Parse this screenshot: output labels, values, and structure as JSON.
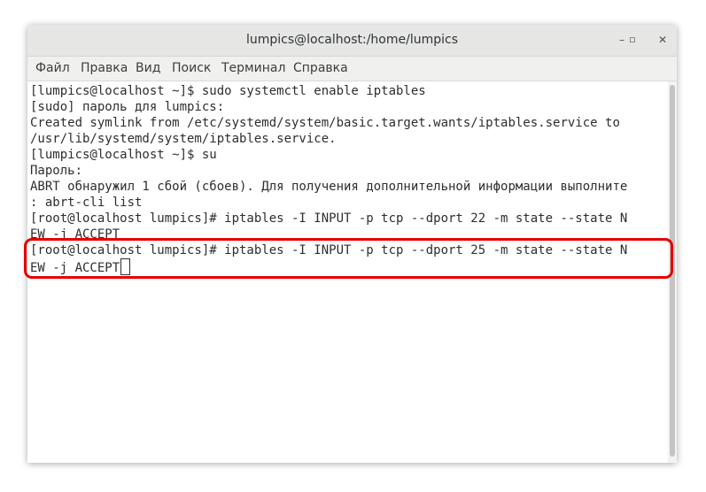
{
  "window": {
    "title": "lumpics@localhost:/home/lumpics",
    "controls": [
      "–",
      "▫",
      "✕"
    ]
  },
  "menu": [
    "Файл",
    "Правка",
    "Вид",
    "Поиск",
    "Терминал",
    "Справка"
  ],
  "terminal": {
    "lines": [
      "[lumpics@localhost ~]$ sudo systemctl enable iptables",
      "[sudo] пароль для lumpics:",
      "Created symlink from /etc/systemd/system/basic.target.wants/iptables.service to",
      "/usr/lib/systemd/system/iptables.service.",
      "[lumpics@localhost ~]$ su",
      "Пароль:",
      "ABRT обнаружил 1 сбой (сбоев). Для получения дополнительной информации выполните",
      ": abrt-cli list",
      "[root@localhost lumpics]# iptables -I INPUT -p tcp --dport 22 -m state --state N",
      "EW -j ACCEPT",
      "[root@localhost lumpics]# iptables -I INPUT -p tcp --dport 25 -m state --state N",
      "EW -j ACCEPT"
    ]
  },
  "colors": {
    "highlight": "#e60000"
  }
}
